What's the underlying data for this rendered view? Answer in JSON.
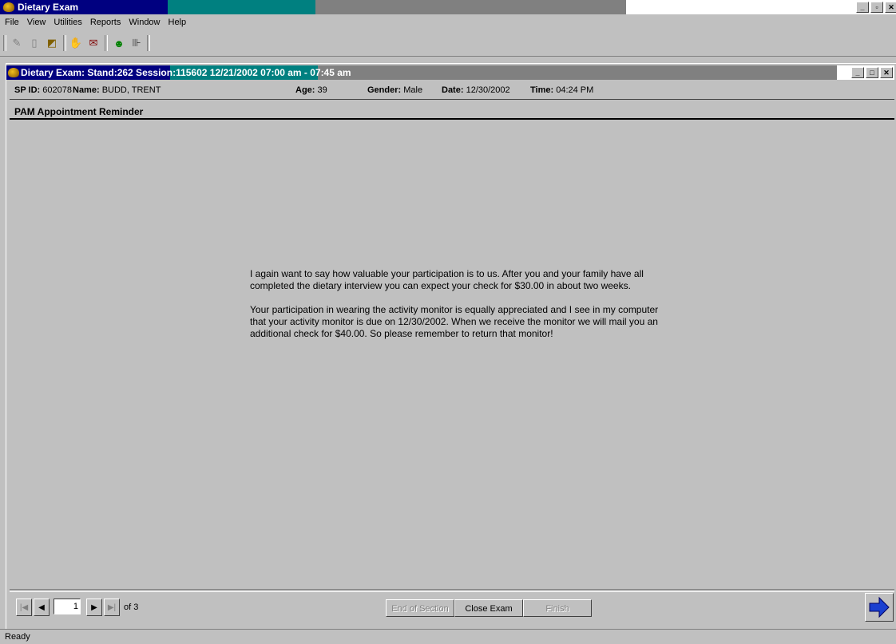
{
  "app": {
    "title": "Dietary Exam",
    "menu": [
      "File",
      "View",
      "Utilities",
      "Reports",
      "Window",
      "Help"
    ]
  },
  "toolbar": {
    "icons": [
      "new-exam-icon",
      "clipboard-icon",
      "open-icon",
      "stop-hand-icon",
      "notes-icon",
      "people-icon",
      "exit-door-icon"
    ]
  },
  "inner_window": {
    "title": "Dietary Exam: Stand:262 Session:115602 12/21/2002 07:00 am - 07:45 am"
  },
  "participant": {
    "sp_id_label": "SP ID:",
    "sp_id": "602078",
    "name_label": "Name:",
    "name": "BUDD, TRENT",
    "age_label": "Age:",
    "age": "39",
    "gender_label": "Gender:",
    "gender": "Male",
    "date_label": "Date:",
    "date": "12/30/2002",
    "time_label": "Time:",
    "time": "04:24 PM"
  },
  "section": {
    "title": "PAM Appointment Reminder",
    "paragraph1": "I again want to say how valuable your participation is to us.  After you and your family have all completed the dietary interview you can expect your check for $30.00 in about two weeks.",
    "paragraph2": "Your participation in wearing the activity monitor is equally appreciated and I see in my computer that your activity monitor is due on 12/30/2002.  When we receive the monitor we will mail you an additional check for $40.00.  So please remember to return that monitor!"
  },
  "navigation": {
    "page_value": "1",
    "page_of": "of 3"
  },
  "buttons": {
    "end_of_section": "End of Section",
    "close_exam": "Close Exam",
    "finish": "Finish"
  },
  "status": {
    "text": "Ready"
  }
}
